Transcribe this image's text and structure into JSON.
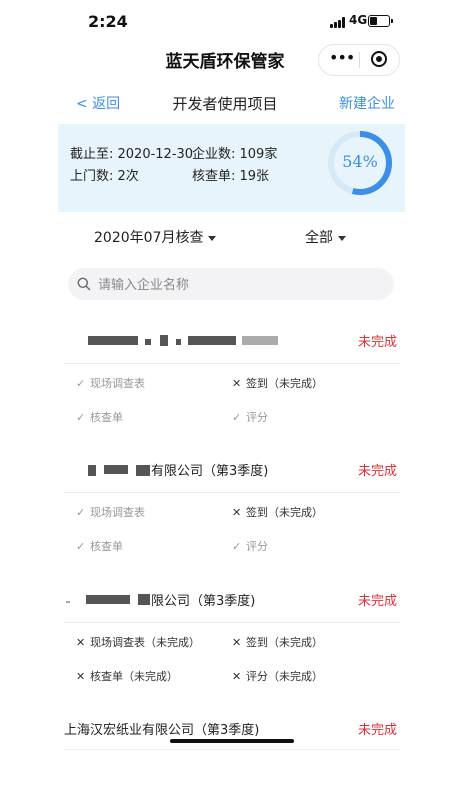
{
  "status_bar": {
    "time": "2:24",
    "network": "4G"
  },
  "app": {
    "title": "蓝天盾环保管家",
    "menu_icon": "more-dots-icon",
    "close_icon": "target-icon"
  },
  "nav": {
    "back_label": "< 返回",
    "title": "开发者使用项目",
    "new_label": "新建企业"
  },
  "summary": {
    "deadline_label": "截止至: 2020-12-30",
    "company_count_label": "企业数: 109家",
    "visits_label": "上门数: 2次",
    "checklist_label": "核查单: 19张",
    "progress_percent": 54,
    "progress_display": "54%",
    "accent_color": "#3b8fe6"
  },
  "filters": {
    "month_label": "2020年07月核查",
    "scope_label": "全部"
  },
  "search": {
    "placeholder": "请输入企业名称"
  },
  "companies": [
    {
      "name": "",
      "status": "未完成",
      "tasks": [
        {
          "label": "现场调查表",
          "done": true
        },
        {
          "label": "签到（未完成）",
          "done": false
        },
        {
          "label": "核查单",
          "done": true
        },
        {
          "label": "评分",
          "done": true
        }
      ]
    },
    {
      "name": "有限公司（第3季度)",
      "status": "未完成",
      "tasks": [
        {
          "label": "现场调查表",
          "done": true
        },
        {
          "label": "签到（未完成）",
          "done": false
        },
        {
          "label": "核查单",
          "done": true
        },
        {
          "label": "评分",
          "done": true
        }
      ]
    },
    {
      "name": "限公司（第3季度)",
      "status": "未完成",
      "tasks": [
        {
          "label": "现场调查表（未完成）",
          "done": false
        },
        {
          "label": "签到（未完成）",
          "done": false
        },
        {
          "label": "核查单（未完成）",
          "done": false
        },
        {
          "label": "评分（未完成）",
          "done": false
        }
      ]
    },
    {
      "name": "上海汉宏纸业有限公司（第3季度)",
      "status": "未完成",
      "tasks": []
    }
  ],
  "colors": {
    "status_incomplete": "#e0303a",
    "link": "#3b8fe6",
    "summary_bg": "#e8f4fb"
  }
}
